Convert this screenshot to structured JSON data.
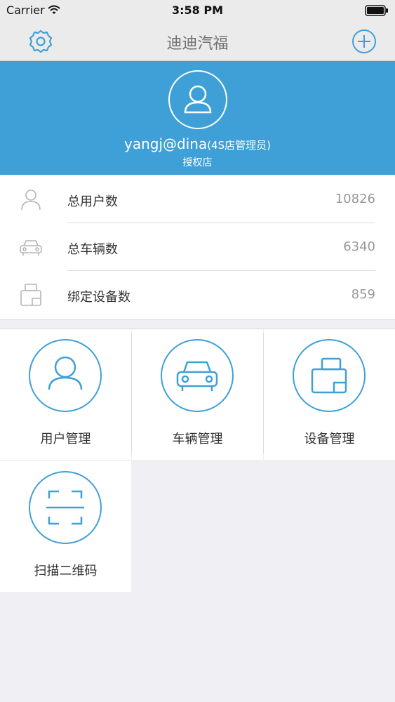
{
  "status_bar": {
    "carrier": "Carrier",
    "time": "3:58 PM",
    "wifi_icon": "wifi-icon",
    "battery_icon": "battery-icon"
  },
  "nav": {
    "title": "迪迪汽福",
    "left_icon": "settings-gear-icon",
    "right_icon": "add-circle-icon"
  },
  "profile": {
    "username": "yangj@dina",
    "role": "(4S店管理员)",
    "store": "授权店",
    "avatar_icon": "user-avatar-icon"
  },
  "stats": [
    {
      "label": "总用户数",
      "value": "10826",
      "icon": "user-icon"
    },
    {
      "label": "总车辆数",
      "value": "6340",
      "icon": "car-icon"
    },
    {
      "label": "绑定设备数",
      "value": "859",
      "icon": "device-icon"
    }
  ],
  "menu": [
    {
      "label": "用户管理",
      "icon": "user-icon"
    },
    {
      "label": "车辆管理",
      "icon": "car-icon"
    },
    {
      "label": "设备管理",
      "icon": "device-icon"
    },
    {
      "label": "扫描二维码",
      "icon": "scan-icon"
    }
  ],
  "colors": {
    "accent": "#3fa0d8",
    "background": "#efeff4",
    "nav_bar": "#ebebeb",
    "value_gray": "#999999"
  }
}
